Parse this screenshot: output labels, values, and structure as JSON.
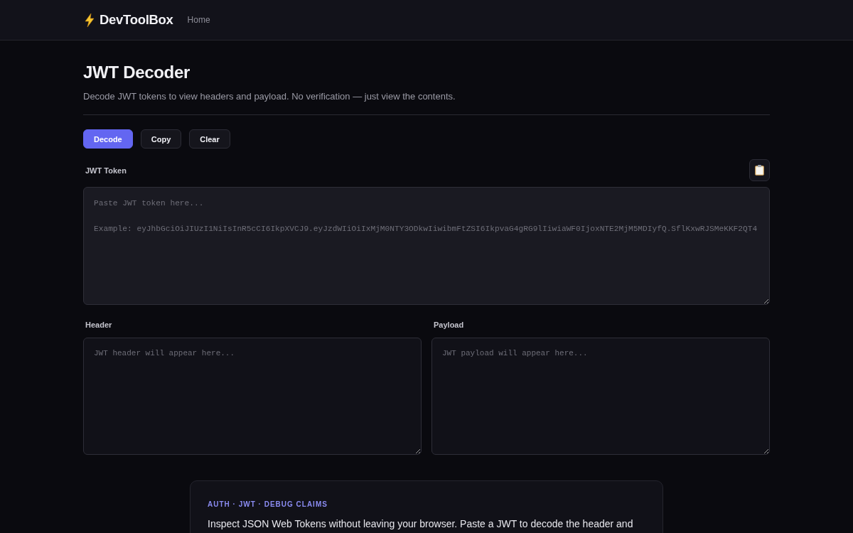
{
  "nav": {
    "brand": "DevToolBox",
    "links": [
      {
        "label": "Home"
      }
    ]
  },
  "page": {
    "title": "JWT Decoder",
    "subtitle": "Decode JWT tokens to view headers and payload. No verification — just view the contents."
  },
  "toolbar": {
    "buttons": [
      {
        "label": "Decode",
        "kind": "primary"
      },
      {
        "label": "Copy",
        "kind": "secondary"
      },
      {
        "label": "Clear",
        "kind": "secondary"
      }
    ]
  },
  "token_input": {
    "label": "JWT Token",
    "placeholder": "Paste JWT token here...\n\nExample: eyJhbGciOiJIUzI1NiIsInR5cCI6IkpXVCJ9.eyJzdWIiOiIxMjM0NTY3ODkwIiwibmFtZSI6IkpvaG4gRG9lIiwiaWF0IjoxNTE2MjM5MDIyfQ.SflKxwRJSMeKKF2QT4"
  },
  "outputs": [
    {
      "label": "Header",
      "placeholder": "JWT header will appear here..."
    },
    {
      "label": "Payload",
      "placeholder": "JWT payload will appear here..."
    }
  ],
  "info_card": {
    "eyebrow": "AUTH · JWT · DEBUG CLAIMS",
    "text": "Inspect JSON Web Tokens without leaving your browser. Paste a JWT to decode the header and"
  }
}
